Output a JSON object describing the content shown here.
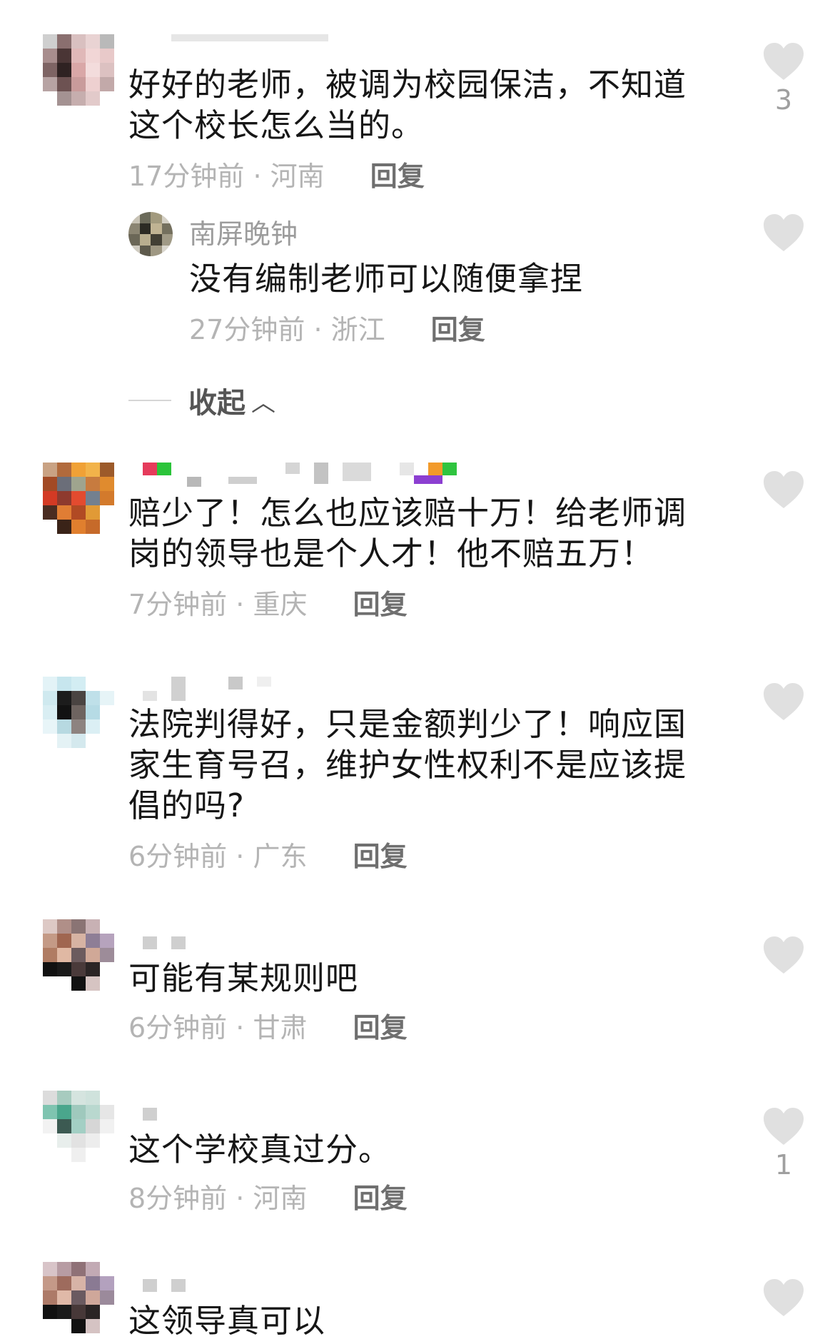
{
  "comments": [
    {
      "text": "好好的老师，被调为校园保洁，不知道这个校长怎么当的。",
      "time": "17分钟前",
      "location": "河南",
      "reply": "回复",
      "likes": "3",
      "replies": [
        {
          "username": "南屏晚钟",
          "text": "没有编制老师可以随便拿捏",
          "time": "27分钟前",
          "location": "浙江",
          "reply": "回复"
        }
      ]
    },
    {
      "text": "赔少了！怎么也应该赔十万！给老师调岗的领导也是个人才！他不赔五万！",
      "time": "7分钟前",
      "location": "重庆",
      "reply": "回复"
    },
    {
      "text": "法院判得好，只是金额判少了！响应国家生育号召，维护女性权利不是应该提倡的吗?",
      "time": "6分钟前",
      "location": "广东",
      "reply": "回复"
    },
    {
      "text": "可能有某规则吧",
      "time": "6分钟前",
      "location": "甘肃",
      "reply": "回复"
    },
    {
      "text": "这个学校真过分。",
      "time": "8分钟前",
      "location": "河南",
      "reply": "回复",
      "likes": "1"
    },
    {
      "text": "这领导真可以"
    }
  ],
  "collapse_label": "收起",
  "separator": "·",
  "colors": {
    "heart": "#e0e0e0",
    "meta": "#b4b4b4",
    "reply": "#6f6f6f"
  },
  "icons": {
    "like": "heart-icon",
    "collapse": "chevron-up-icon"
  }
}
